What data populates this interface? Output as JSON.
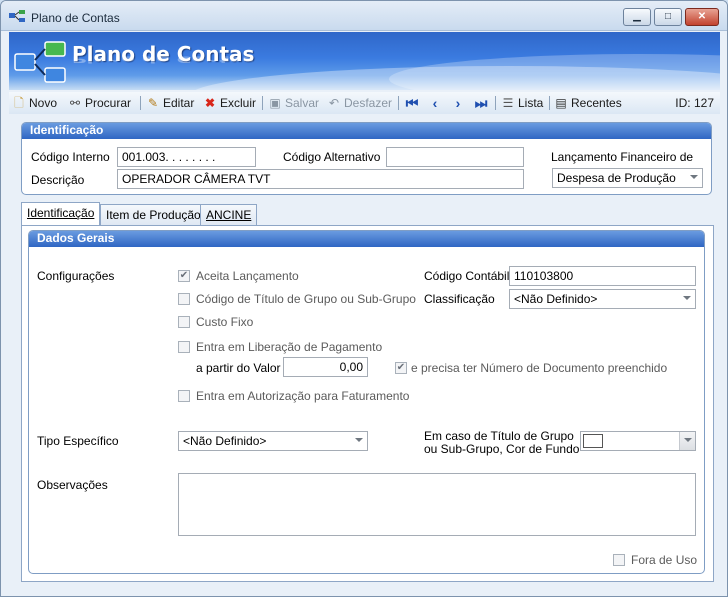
{
  "window": {
    "title": "Plano de Contas",
    "controls": {
      "minimize": "▁",
      "maximize": "□",
      "close": "✕"
    }
  },
  "banner": {
    "heading": "Plano de Contas"
  },
  "toolbar": {
    "novo": "Novo",
    "procurar": "Procurar",
    "editar": "Editar",
    "excluir": "Excluir",
    "salvar": "Salvar",
    "desfazer": "Desfazer",
    "lista": "Lista",
    "recentes": "Recentes",
    "record_id": "ID: 127"
  },
  "identificacao": {
    "header": "Identificação",
    "codigo_interno_label": "Código Interno",
    "codigo_interno_value": "001.003.  .  .  .  .  .  .  .",
    "codigo_alternativo_label": "Código Alternativo",
    "codigo_alternativo_value": "",
    "lancamento_label": "Lançamento Financeiro de",
    "lancamento_value": "Despesa de Produção",
    "descricao_label": "Descrição",
    "descricao_value": "OPERADOR CÂMERA TVT"
  },
  "tabs": [
    "Identificação",
    "Item de Produção",
    "ANCINE"
  ],
  "dados_gerais": {
    "header": "Dados Gerais",
    "configuracoes_label": "Configurações",
    "aceita_lancamento": "Aceita Lançamento",
    "codigo_titulo": "Código de Título de Grupo ou Sub-Grupo",
    "custo_fixo": "Custo Fixo",
    "entra_liberacao": "Entra em Liberação de Pagamento",
    "a_partir_label": "a partir do Valor",
    "a_partir_value": "0,00",
    "precisa_numero": "e precisa ter Número de Documento preenchido",
    "entra_autorizacao": "Entra em Autorização para Faturamento",
    "codigo_contabil_label": "Código Contábil",
    "codigo_contabil_value": "110103800",
    "classificacao_label": "Classificação",
    "classificacao_value": "<Não Definido>",
    "tipo_especifico_label": "Tipo Específico",
    "tipo_especifico_value": "<Não Definido>",
    "cor_fundo_label_1": "Em caso de Título de Grupo",
    "cor_fundo_label_2": "ou Sub-Grupo, Cor de Fundo",
    "observacoes_label": "Observações",
    "observacoes_value": "",
    "fora_de_uso": "Fora de Uso"
  },
  "checks": {
    "aceita_lancamento": true,
    "precisa_numero": true
  }
}
